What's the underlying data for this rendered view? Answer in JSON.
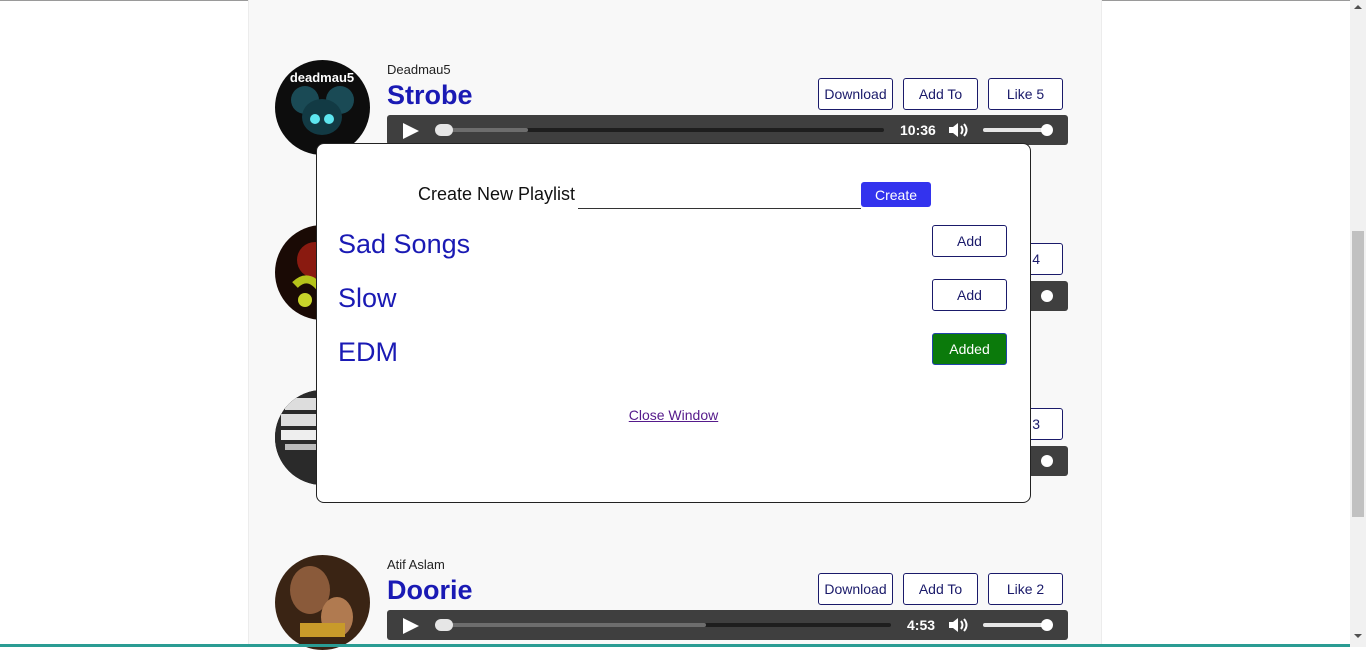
{
  "songs": [
    {
      "artist": "Deadmau5",
      "title": "Strobe",
      "download": "Download",
      "add_to": "Add To",
      "like": "Like 5",
      "time": "10:36"
    },
    {
      "like_partial": "4"
    },
    {
      "like_partial": "3"
    },
    {
      "artist": "Atif Aslam",
      "title": "Doorie",
      "download": "Download",
      "add_to": "Add To",
      "like": "Like 2",
      "time": "4:53"
    }
  ],
  "modal": {
    "create_label": "Create New Playlist",
    "create_input_value": "",
    "create_button": "Create",
    "playlists": [
      {
        "name": "Sad Songs",
        "button": "Add",
        "state": "default"
      },
      {
        "name": "Slow",
        "button": "Add",
        "state": "default"
      },
      {
        "name": "EDM",
        "button": "Added",
        "state": "added"
      }
    ],
    "close_link": "Close Window"
  },
  "colors": {
    "accent_blue": "#1a1ab4",
    "create_button": "#3333ee",
    "added_green": "#0b7a0b",
    "player_bg": "#3f3f3f"
  }
}
